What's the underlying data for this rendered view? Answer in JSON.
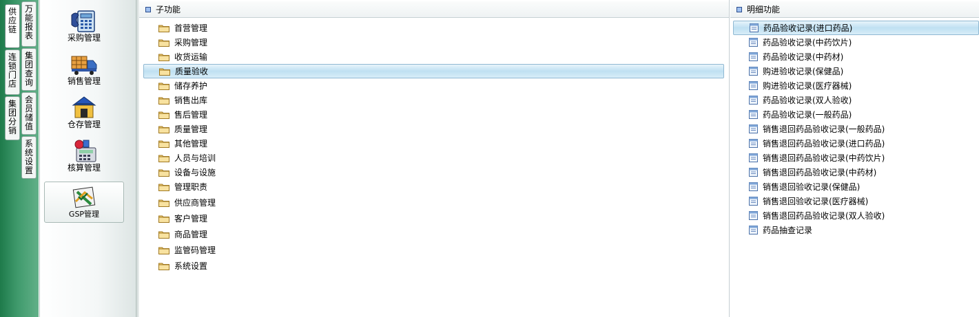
{
  "left_tabs": {
    "outer": [
      "供应链",
      "连锁门店",
      "集团分销"
    ],
    "inner": [
      "万能报表",
      "集团查询",
      "会员储值",
      "系统设置"
    ]
  },
  "modules": [
    {
      "label": "采购管理",
      "icon": "phone-calculator-icon"
    },
    {
      "label": "销售管理",
      "icon": "delivery-truck-icon"
    },
    {
      "label": "仓存管理",
      "icon": "warehouse-icon"
    },
    {
      "label": "核算管理",
      "icon": "accounting-calculator-icon"
    },
    {
      "label": "GSP管理",
      "icon": "gsp-check-icon",
      "selected": true
    }
  ],
  "sub_panel": {
    "title": "子功能",
    "selected": "质量验收",
    "items": [
      "首营管理",
      "采购管理",
      "收货运输",
      "质量验收",
      "储存养护",
      "销售出库",
      "售后管理",
      "质量管理",
      "其他管理",
      "人员与培训",
      "设备与设施",
      "管理职责",
      "供应商管理",
      "客户管理",
      "商品管理",
      "监管码管理",
      "系统设置"
    ]
  },
  "detail_panel": {
    "title": "明细功能",
    "selected": "药品验收记录(进口药品)",
    "items": [
      "药品验收记录(进口药品)",
      "药品验收记录(中药饮片)",
      "药品验收记录(中药材)",
      "购进验收记录(保健品)",
      "购进验收记录(医疗器械)",
      "药品验收记录(双人验收)",
      "药品验收记录(一般药品)",
      "销售退回药品验收记录(一般药品)",
      "销售退回药品验收记录(进口药品)",
      "销售退回药品验收记录(中药饮片)",
      "销售退回药品验收记录(中药材)",
      "销售退回验收记录(保健品)",
      "销售退回验收记录(医疗器械)",
      "销售退回药品验收记录(双人验收)",
      "药品抽查记录"
    ]
  },
  "colors": {
    "accent_green": "#3f9a6c",
    "selection_blue": "#bfe0f2",
    "folder_yellow": "#f3d27a"
  }
}
